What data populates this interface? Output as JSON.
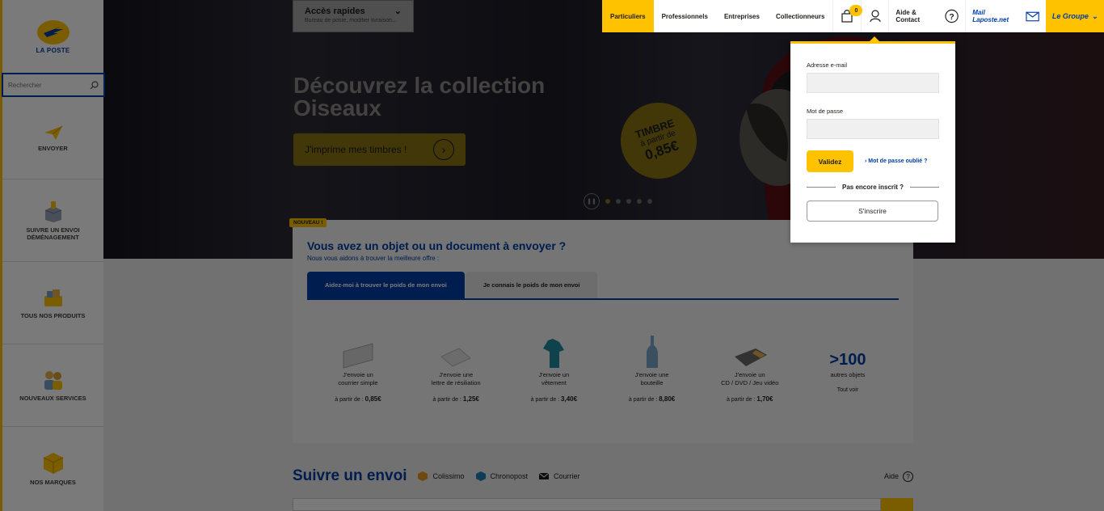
{
  "sidebar": {
    "logo_text": "LA POSTE",
    "search_placeholder": "Rechercher",
    "items": [
      {
        "label": "ENVOYER"
      },
      {
        "label": "SUIVRE UN ENVOI\nDÉMÉNAGEMENT"
      },
      {
        "label": "TOUS NOS PRODUITS"
      },
      {
        "label": "NOUVEAUX SERVICES"
      },
      {
        "label": "NOS MARQUES"
      }
    ]
  },
  "quick_access": {
    "title": "Accès rapides",
    "subtitle": "Bureau de poste, modifier livraison..."
  },
  "topnav": {
    "items": [
      "Particuliers",
      "Professionnels",
      "Entreprises",
      "Collectionneurs"
    ],
    "cart_count": "0",
    "help": "Aide & Contact",
    "mail": "Mail Laposte.net",
    "groupe": "Le Groupe"
  },
  "hero": {
    "title": "Découvrez la collection Oiseaux",
    "cta": "J'imprime mes timbres !",
    "stamp_line1": "TIMBRE",
    "stamp_line2": "à partir de",
    "stamp_price": "0,85€"
  },
  "login": {
    "email_label": "Adresse e-mail",
    "password_label": "Mot de passe",
    "submit": "Validez",
    "forgot": "Mot de passe oublié ?",
    "not_registered": "Pas encore inscrit ?",
    "register": "S'inscrire"
  },
  "send": {
    "badge": "NOUVEAU !",
    "title": "Vous avez un objet ou un document à envoyer ?",
    "subtitle": "Nous vous aidons à trouver la meilleure offre :",
    "tab_active": "Aidez-moi à trouver le poids de mon envoi",
    "tab_inactive": "Je connais le poids de mon envoi",
    "products": [
      {
        "line1": "J'envoie un",
        "line2": "courrier simple",
        "prefix": "à partir de :",
        "price": "0,85€"
      },
      {
        "line1": "J'envoie une",
        "line2": "lettre de résiliation",
        "prefix": "à partir de :",
        "price": "1,25€"
      },
      {
        "line1": "J'envoie un",
        "line2": "vêtement",
        "prefix": "à partir de :",
        "price": "3,40€"
      },
      {
        "line1": "J'envoie une",
        "line2": "bouteille",
        "prefix": "à partir de :",
        "price": "8,80€"
      },
      {
        "line1": "J'envoie un",
        "line2": "CD / DVD / Jeu vidéo",
        "prefix": "à partir de :",
        "price": "1,70€"
      }
    ],
    "more_value": ">100",
    "more_label": "autres objets",
    "see_all": "Tout voir"
  },
  "tracking": {
    "title": "Suivre un envoi",
    "carriers": [
      "Colissimo",
      "Chronopost",
      "Courrier"
    ],
    "help": "Aide"
  },
  "colors": {
    "yellow": "#ffc200",
    "blue": "#003da5"
  }
}
